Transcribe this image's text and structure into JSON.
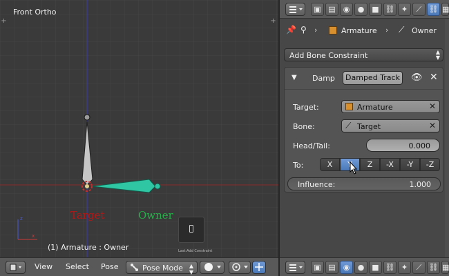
{
  "viewport": {
    "title": "Front Ortho",
    "status": "(1) Armature : Owner",
    "label_target": "Target",
    "label_owner": "Owner",
    "note": "Last:Add Constraint"
  },
  "header": {
    "menus": [
      "View",
      "Select",
      "Pose"
    ],
    "mode": "Pose Mode"
  },
  "properties": {
    "breadcrumb": [
      "Armature",
      "Owner"
    ],
    "add_constraint": "Add Bone Constraint",
    "constraint": {
      "name": "Damp",
      "type": "Damped Track",
      "target_label": "Target:",
      "target_value": "Armature",
      "bone_label": "Bone:",
      "bone_value": "Target",
      "headtail_label": "Head/Tail:",
      "headtail_value": "0.000",
      "to_label": "To:",
      "axes": [
        "X",
        "Y",
        "Z",
        "-X",
        "-Y",
        "-Z"
      ],
      "active_axis": "Y",
      "influence_label": "Influence:",
      "influence_value": "1.000"
    }
  },
  "colors": {
    "accent": "#5680c2",
    "target_label": "#b21818",
    "owner_label": "#26b04a",
    "bone_selected": "#2fc7a3"
  }
}
